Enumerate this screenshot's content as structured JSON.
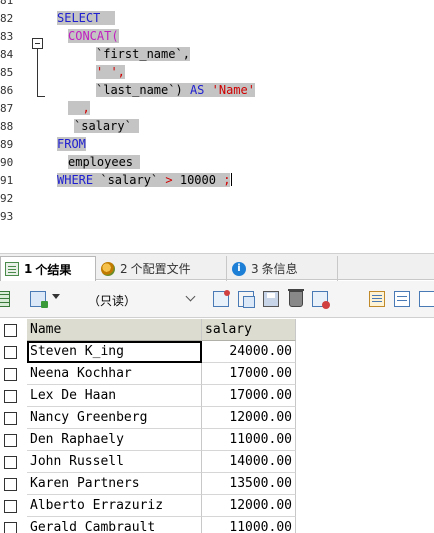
{
  "editor": {
    "line_numbers": [
      "81",
      "82",
      "83",
      "84",
      "85",
      "86",
      "87",
      "88",
      "89",
      "90",
      "91",
      "92",
      "93"
    ],
    "code": {
      "select": "SELECT",
      "concat": "CONCAT(",
      "first_name": "`first_name`,",
      "sep": "' ',",
      "last_name": "`last_name`)",
      "as": "AS",
      "alias": "'Name'",
      "comma": ",",
      "salary": "`salary`",
      "from": "FROM",
      "table": "employees",
      "where": "WHERE",
      "where_col": "`salary`",
      "gt": ">",
      "where_val": "10000",
      "semicolon": ";"
    }
  },
  "tabs": [
    {
      "num": "1",
      "label": "个结果"
    },
    {
      "num": "2",
      "label": "个配置文件"
    },
    {
      "num": "3",
      "label": "条信息"
    }
  ],
  "toolbar": {
    "mode_value": "（只读）"
  },
  "grid": {
    "columns": [
      "Name",
      "salary"
    ],
    "rows": [
      {
        "name": "Steven K_ing",
        "salary": "24000.00"
      },
      {
        "name": "Neena Kochhar",
        "salary": "17000.00"
      },
      {
        "name": "Lex De Haan",
        "salary": "17000.00"
      },
      {
        "name": "Nancy Greenberg",
        "salary": "12000.00"
      },
      {
        "name": "Den Raphaely",
        "salary": "11000.00"
      },
      {
        "name": "John Russell",
        "salary": "14000.00"
      },
      {
        "name": "Karen Partners",
        "salary": "13500.00"
      },
      {
        "name": "Alberto Errazuriz",
        "salary": "12000.00"
      },
      {
        "name": "Gerald Cambrault",
        "salary": "11000.00"
      }
    ]
  },
  "colors": {
    "keyword": "#2020d0",
    "function": "#c020c0",
    "string": "#d00000",
    "selection": "#c4c4c4",
    "header_bg": "#dcdcd0"
  }
}
